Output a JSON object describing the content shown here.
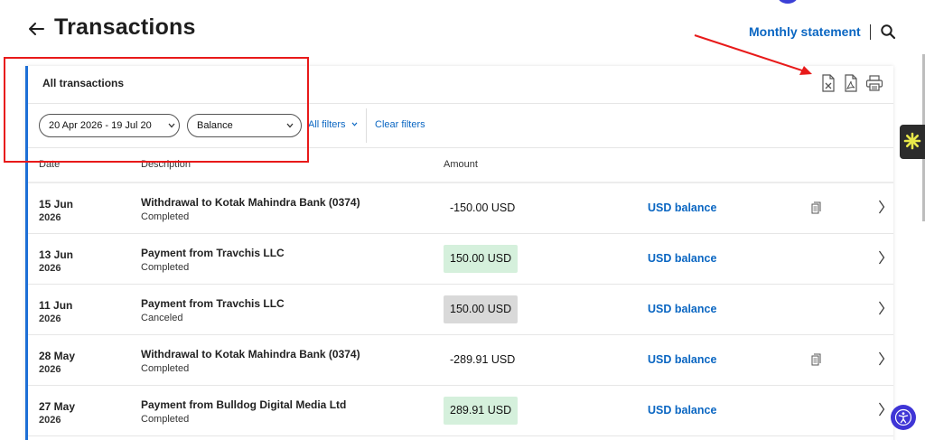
{
  "header": {
    "title": "Transactions",
    "monthly_statement": "Monthly statement"
  },
  "card": {
    "heading": "All transactions",
    "filters": {
      "date_range": "20 Apr 2026 - 19 Jul 20",
      "balance": "Balance",
      "all_filters": "All filters",
      "clear_filters": "Clear filters"
    },
    "columns": {
      "date": "Date",
      "description": "Description",
      "amount": "Amount"
    }
  },
  "transactions": [
    {
      "day": "15 Jun",
      "year": "2026",
      "description": "Withdrawal to Kotak Mahindra Bank (0374)",
      "status": "Completed",
      "amount": "-150.00 USD",
      "amount_style": "plain",
      "balance": "USD balance",
      "has_doc": true
    },
    {
      "day": "13 Jun",
      "year": "2026",
      "description": "Payment from Travchis LLC",
      "status": "Completed",
      "amount": "150.00 USD",
      "amount_style": "green",
      "balance": "USD balance",
      "has_doc": false
    },
    {
      "day": "11 Jun",
      "year": "2026",
      "description": "Payment from Travchis LLC",
      "status": "Canceled",
      "amount": "150.00 USD",
      "amount_style": "grey",
      "balance": "USD balance",
      "has_doc": false
    },
    {
      "day": "28 May",
      "year": "2026",
      "description": "Withdrawal to Kotak Mahindra Bank (0374)",
      "status": "Completed",
      "amount": "-289.91 USD",
      "amount_style": "plain",
      "balance": "USD balance",
      "has_doc": true
    },
    {
      "day": "27 May",
      "year": "2026",
      "description": "Payment from Bulldog Digital Media Ltd",
      "status": "Completed",
      "amount": "289.91 USD",
      "amount_style": "green",
      "balance": "USD balance",
      "has_doc": false
    }
  ],
  "colors": {
    "accent_blue": "#0a66c2",
    "card_left_border": "#1d6fd6",
    "annotation_red": "#e81a1a",
    "credit_green_bg": "#d5f0dc",
    "canceled_grey_bg": "#d9d9d9",
    "accessibility_purple": "#3f35d6"
  },
  "icons": {
    "back": "arrow-left-icon",
    "search": "search-icon",
    "export_excel": "excel-export-icon",
    "export_pdf": "pdf-export-icon",
    "print": "print-icon",
    "receipt": "receipt-icon",
    "row_open": "chevron-right-icon",
    "side_widget": "sparkle-icon",
    "accessibility": "accessibility-icon"
  }
}
